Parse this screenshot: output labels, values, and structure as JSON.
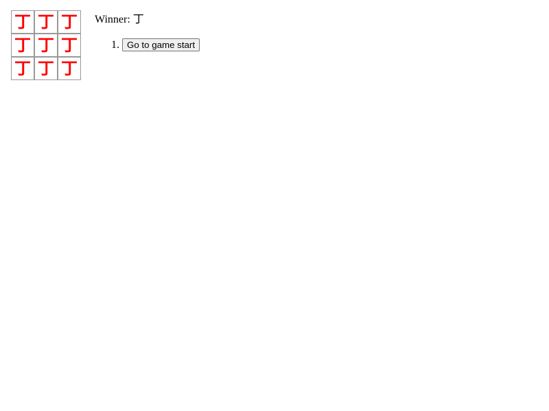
{
  "board": {
    "mark_color": "#ff0000",
    "squares": [
      {
        "mark": "丁"
      },
      {
        "mark": "丁"
      },
      {
        "mark": "丁"
      },
      {
        "mark": "丁"
      },
      {
        "mark": "丁"
      },
      {
        "mark": "丁"
      },
      {
        "mark": "丁"
      },
      {
        "mark": "丁"
      },
      {
        "mark": "丁"
      }
    ]
  },
  "status": {
    "label": "Winner: ",
    "winner": "丁"
  },
  "moves": [
    {
      "label": "Go to game start"
    }
  ]
}
